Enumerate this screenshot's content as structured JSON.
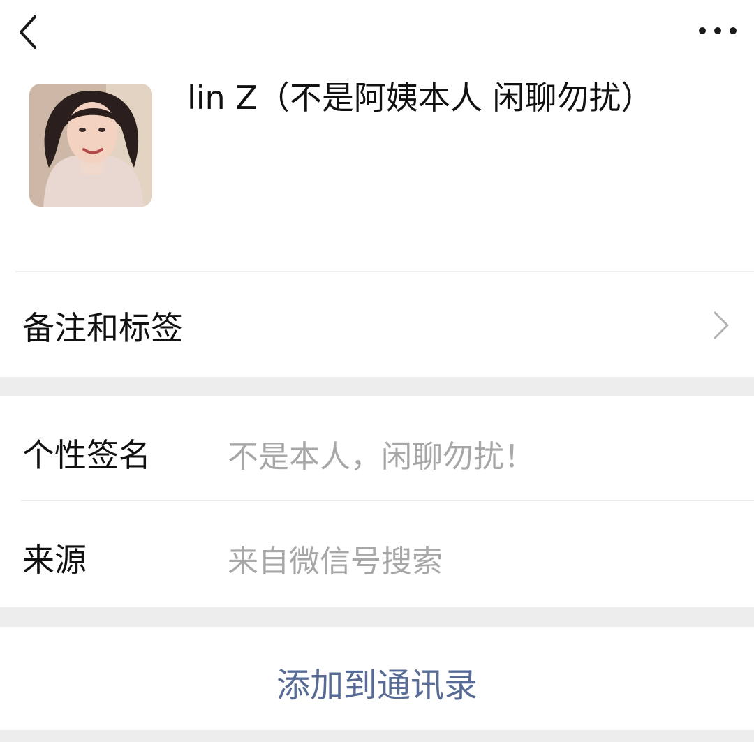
{
  "nav": {
    "back_icon": "chevron-left-icon",
    "more_icon": "more-dots-icon"
  },
  "profile": {
    "name": "lin Z（不是阿姨本人 闲聊勿扰）",
    "avatar_icon": "user-avatar-photo"
  },
  "menu": {
    "remarks_label": "备注和标签",
    "chevron_icon": "chevron-right-icon"
  },
  "details": {
    "signature_label": "个性签名",
    "signature_value": "不是本人，闲聊勿扰！",
    "source_label": "来源",
    "source_value": "来自微信号搜索"
  },
  "actions": {
    "add_contact_label": "添加到通讯录"
  },
  "colors": {
    "link": "#576b95",
    "secondary_text": "#a7a7a7",
    "section_gap": "#ededed"
  }
}
